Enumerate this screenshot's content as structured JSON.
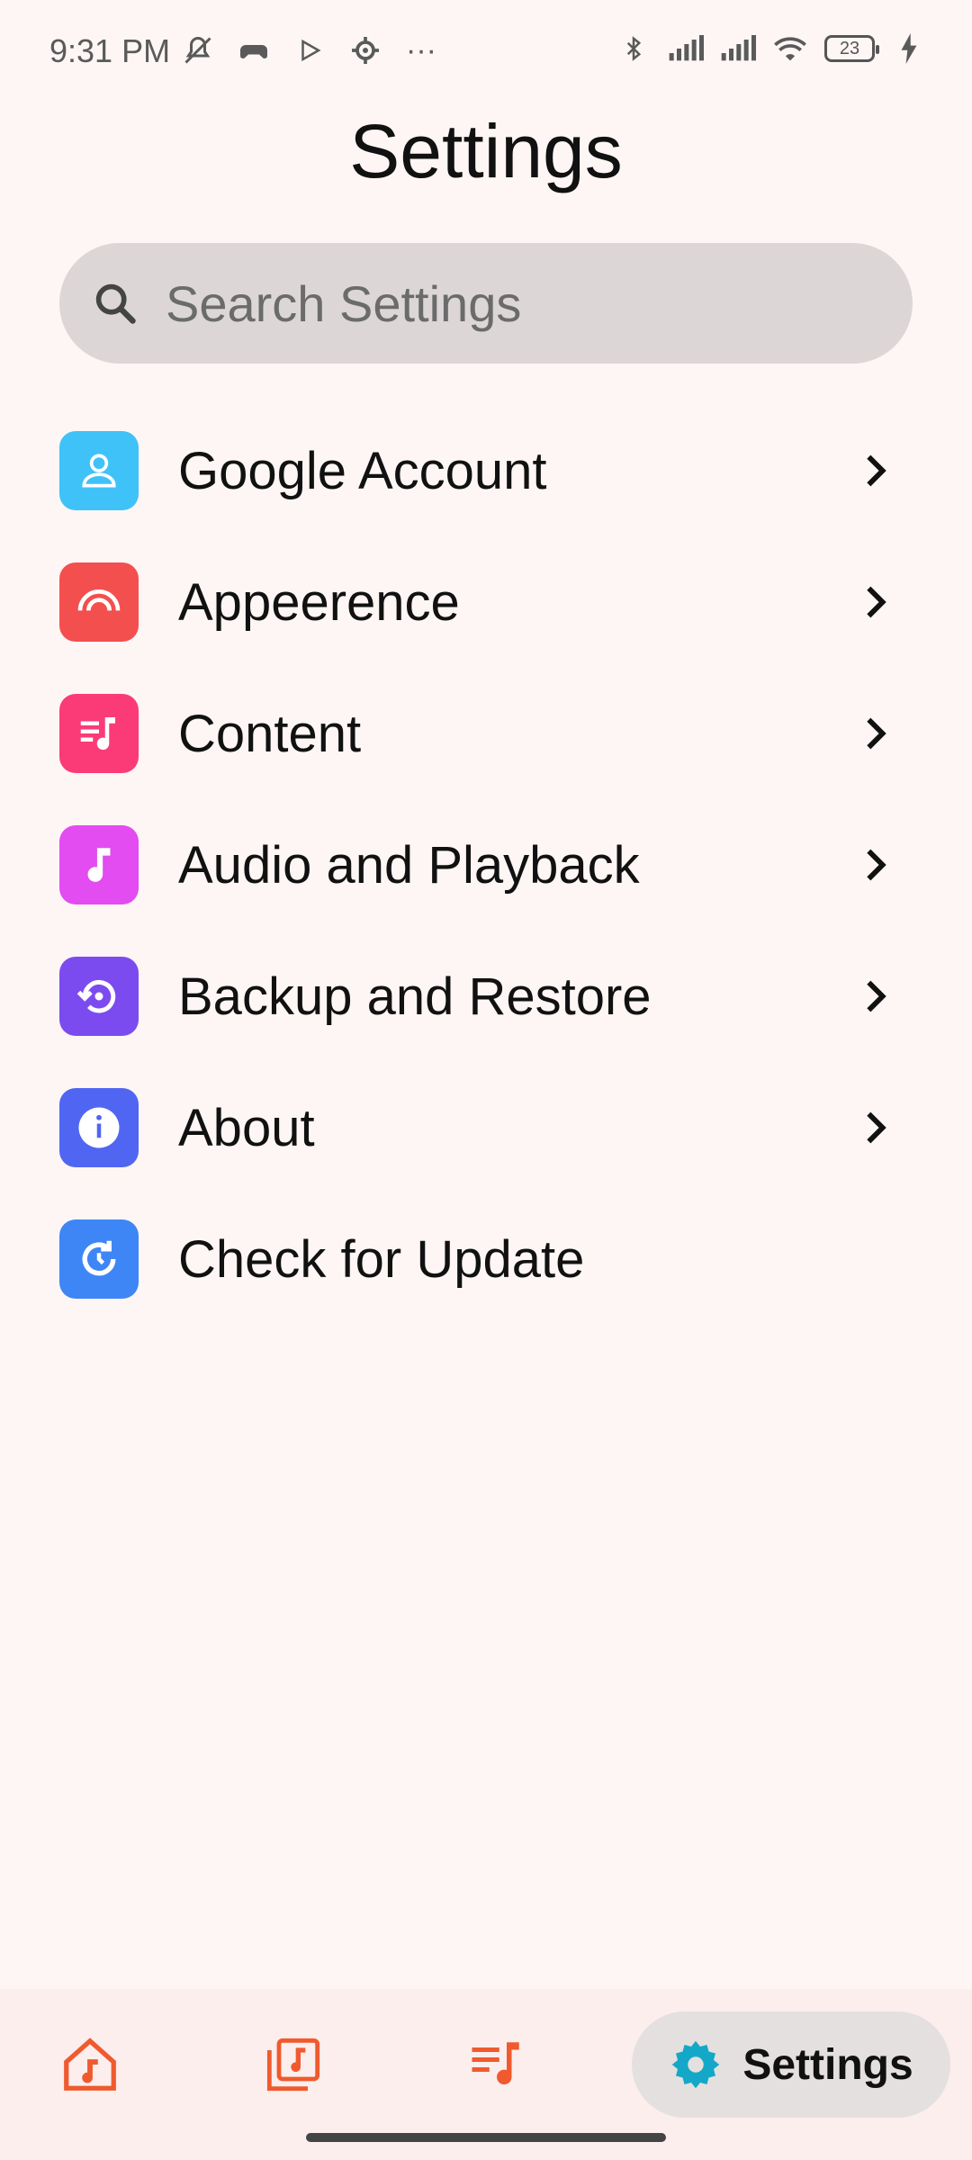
{
  "status_bar": {
    "time": "9:31 PM",
    "battery": "23",
    "icons_left": [
      "mute-bell-icon",
      "controller-icon",
      "play-store-icon",
      "settings-gear-icon",
      "more-dots-icon"
    ],
    "icons_right": [
      "bluetooth-icon",
      "signal-icon",
      "signal-icon",
      "wifi-icon",
      "battery-icon",
      "charging-icon"
    ]
  },
  "header": {
    "title": "Settings"
  },
  "search": {
    "placeholder": "Search Settings"
  },
  "items": [
    {
      "label": "Google Account",
      "icon": "person-icon",
      "color": "#3fc2f8",
      "chevron": true
    },
    {
      "label": "Appeerence",
      "icon": "rainbow-icon",
      "color": "#f44f4f",
      "chevron": true
    },
    {
      "label": "Content",
      "icon": "music-list-icon",
      "color": "#fb3b78",
      "chevron": true
    },
    {
      "label": "Audio and Playback",
      "icon": "music-note-icon",
      "color": "#e24cf0",
      "chevron": true
    },
    {
      "label": "Backup and Restore",
      "icon": "restore-icon",
      "color": "#7c4bf0",
      "chevron": true
    },
    {
      "label": "About",
      "icon": "info-icon",
      "color": "#5066f2",
      "chevron": true
    },
    {
      "label": "Check for Update",
      "icon": "update-icon",
      "color": "#3e86f6",
      "chevron": false
    }
  ],
  "bottom_nav": {
    "items": [
      {
        "icon": "home-music-icon"
      },
      {
        "icon": "library-icon"
      },
      {
        "icon": "playlist-icon"
      }
    ],
    "active": {
      "icon": "settings-gear-icon",
      "label": "Settings"
    },
    "accent": "#f05a2e",
    "active_icon_color": "#14a8c8"
  }
}
